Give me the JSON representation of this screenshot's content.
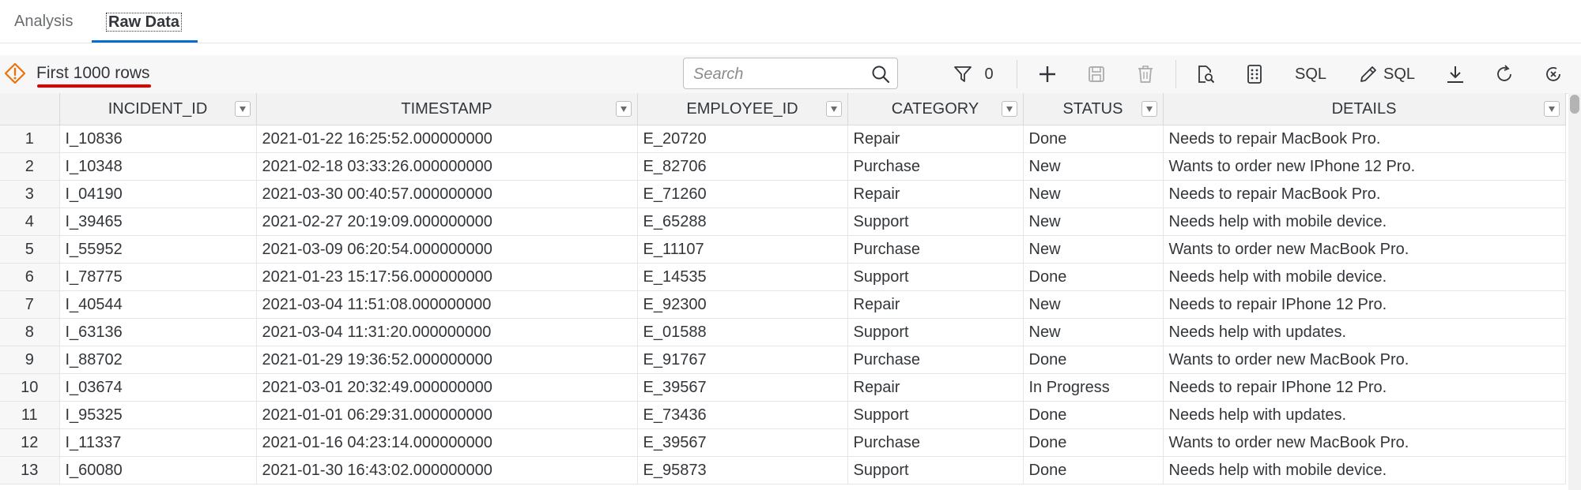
{
  "tabs": [
    {
      "label": "Analysis",
      "active": false
    },
    {
      "label": "Raw Data",
      "active": true
    }
  ],
  "toolbar": {
    "rows_label": "First 1000 rows",
    "search_placeholder": "Search",
    "filter_count": "0",
    "sql_label": "SQL",
    "edit_sql_label": "SQL",
    "icons": [
      "warning-icon",
      "search-icon",
      "filter-icon",
      "add-icon",
      "save-icon",
      "delete-icon",
      "inspect-icon",
      "column-settings-icon",
      "edit-icon",
      "download-icon",
      "refresh-icon",
      "close-icon"
    ]
  },
  "colors": {
    "accent": "#0a6ed1",
    "warning": "#e9730c",
    "highlight_underline": "#e00000"
  },
  "table": {
    "columns": [
      "INCIDENT_ID",
      "TIMESTAMP",
      "EMPLOYEE_ID",
      "CATEGORY",
      "STATUS",
      "DETAILS"
    ],
    "rows": [
      [
        "1",
        "I_10836",
        "2021-01-22 16:25:52.000000000",
        "E_20720",
        "Repair",
        "Done",
        "Needs to repair MacBook Pro."
      ],
      [
        "2",
        "I_10348",
        "2021-02-18 03:33:26.000000000",
        "E_82706",
        "Purchase",
        "New",
        "Wants to order new IPhone 12 Pro."
      ],
      [
        "3",
        "I_04190",
        "2021-03-30 00:40:57.000000000",
        "E_71260",
        "Repair",
        "New",
        "Needs to repair MacBook Pro."
      ],
      [
        "4",
        "I_39465",
        "2021-02-27 20:19:09.000000000",
        "E_65288",
        "Support",
        "New",
        "Needs help with mobile device."
      ],
      [
        "5",
        "I_55952",
        "2021-03-09 06:20:54.000000000",
        "E_11107",
        "Purchase",
        "New",
        "Wants to order new MacBook Pro."
      ],
      [
        "6",
        "I_78775",
        "2021-01-23 15:17:56.000000000",
        "E_14535",
        "Support",
        "Done",
        "Needs help with mobile device."
      ],
      [
        "7",
        "I_40544",
        "2021-03-04 11:51:08.000000000",
        "E_92300",
        "Repair",
        "New",
        "Needs to repair IPhone 12 Pro."
      ],
      [
        "8",
        "I_63136",
        "2021-03-04 11:31:20.000000000",
        "E_01588",
        "Support",
        "New",
        "Needs help with updates."
      ],
      [
        "9",
        "I_88702",
        "2021-01-29 19:36:52.000000000",
        "E_91767",
        "Purchase",
        "Done",
        "Wants to order new MacBook Pro."
      ],
      [
        "10",
        "I_03674",
        "2021-03-01 20:32:49.000000000",
        "E_39567",
        "Repair",
        "In Progress",
        "Needs to repair IPhone 12 Pro."
      ],
      [
        "11",
        "I_95325",
        "2021-01-01 06:29:31.000000000",
        "E_73436",
        "Support",
        "Done",
        "Needs help with updates."
      ],
      [
        "12",
        "I_11337",
        "2021-01-16 04:23:14.000000000",
        "E_39567",
        "Purchase",
        "Done",
        "Wants to order new MacBook Pro."
      ],
      [
        "13",
        "I_60080",
        "2021-01-30 16:43:02.000000000",
        "E_95873",
        "Support",
        "Done",
        "Needs help with mobile device."
      ]
    ]
  }
}
